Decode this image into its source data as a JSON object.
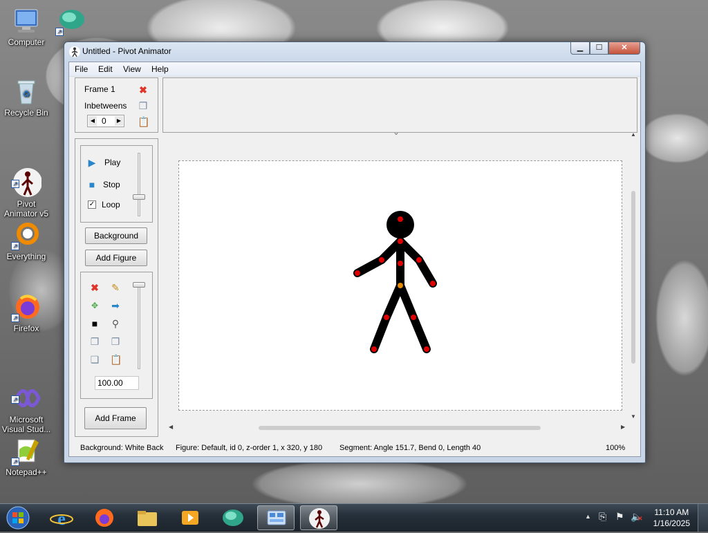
{
  "desktop": {
    "icons": [
      {
        "label": "Computer"
      },
      {
        "label": "Recycle Bin"
      },
      {
        "label": "Pivot\nAnimator v5"
      },
      {
        "label": "Everything"
      },
      {
        "label": "Firefox"
      },
      {
        "label": "Microsoft\nVisual Stud..."
      },
      {
        "label": "Notepad++"
      }
    ]
  },
  "window": {
    "title": "Untitled - Pivot Animator",
    "controls": {
      "minimize": "▁",
      "maximize": "☐",
      "close": "✕"
    }
  },
  "menu": [
    "File",
    "Edit",
    "View",
    "Help"
  ],
  "frame_panel": {
    "frame_label": "Frame 1",
    "inbetweens_label": "Inbetweens",
    "inbetweens_value": "0"
  },
  "playback": {
    "play_label": "Play",
    "stop_label": "Stop",
    "loop_label": "Loop",
    "loop_checked": true
  },
  "buttons": {
    "background": "Background",
    "add_figure": "Add Figure",
    "add_frame": "Add Frame"
  },
  "figure_tools": {
    "scale_value": "100.00"
  },
  "statusbar": {
    "background": "Background: White Back",
    "figure": "Figure: Default,  id 0,  z-order 1,  x 320, y 180",
    "segment": "Segment: Angle 151.7,  Bend 0,  Length 40",
    "zoom": "100%"
  },
  "taskbar": {
    "time": "11:10 AM",
    "date": "1/16/2025"
  },
  "colors": {
    "joint": "#e00000",
    "origin_joint": "#e88a00",
    "figure": "#000000",
    "accent": "#2a6fc9"
  }
}
